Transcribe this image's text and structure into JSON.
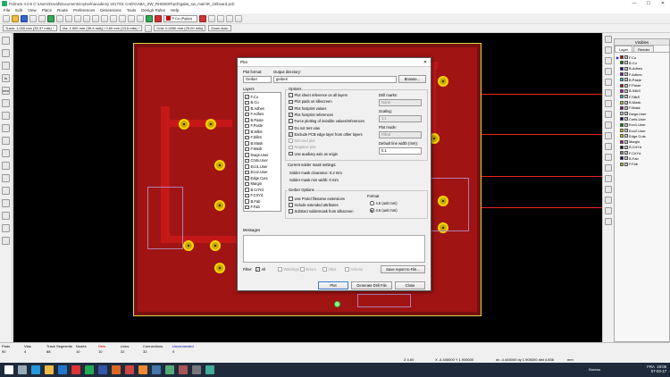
{
  "window": {
    "title": "Pcbnew 4.0.5 C:\\Users\\David\\Documents\\Ayberk\\academy 2017\\01 CAD\\GABA_SW_RHEBOR\\pcb\\gaba_sw_main\\R_15\\board.pcb",
    "minimize": "—",
    "maximize": "☐",
    "close": "✕"
  },
  "menubar": [
    "File",
    "Edit",
    "View",
    "Place",
    "Route",
    "Preferences",
    "Dimensions",
    "Tools",
    "Design Rules",
    "Help"
  ],
  "toolbar": {
    "active_layer": "F.Cu (PgUp)"
  },
  "optionsbar": {
    "track": "Track: 1.000 mm (39.37 mils) *",
    "via": "Via: 1.000 mm (39.4 mils) / 0.60 mm (23.6 mils) *",
    "grid": "Grid: 0.0250 mm (25.00 mils)",
    "zoom": "Zoom Auto"
  },
  "layers_panel": {
    "title": "Visibles",
    "tabs": [
      "Layer",
      "Render"
    ],
    "active_arrow": "▶",
    "rows": [
      {
        "name": "F.Cu",
        "color": "#c00000",
        "checked": true
      },
      {
        "name": "B.Cu",
        "color": "#008000",
        "checked": true
      },
      {
        "name": "B.Adhes",
        "color": "#0000c0",
        "checked": true
      },
      {
        "name": "F.Adhes",
        "color": "#8000c0",
        "checked": true
      },
      {
        "name": "B.Paste",
        "color": "#00c0c0",
        "checked": true
      },
      {
        "name": "F.Paste",
        "color": "#c00000",
        "checked": true
      },
      {
        "name": "B.SilkS",
        "color": "#c000c0",
        "checked": true
      },
      {
        "name": "F.SilkS",
        "color": "#00c0c0",
        "checked": true
      },
      {
        "name": "B.Mask",
        "color": "#c0c000",
        "checked": true
      },
      {
        "name": "F.Mask",
        "color": "#800080",
        "checked": true
      },
      {
        "name": "Dwgs.User",
        "color": "#c0c0c0",
        "checked": true
      },
      {
        "name": "Cmts.User",
        "color": "#000080",
        "checked": true
      },
      {
        "name": "Eco1.User",
        "color": "#008000",
        "checked": true
      },
      {
        "name": "Eco2.User",
        "color": "#c0c000",
        "checked": true
      },
      {
        "name": "Edge.Cuts",
        "color": "#c0c000",
        "checked": true
      },
      {
        "name": "Margin",
        "color": "#c000c0",
        "checked": true
      },
      {
        "name": "B.CrtYd",
        "color": "#000000",
        "checked": true
      },
      {
        "name": "F.CrtYd",
        "color": "#808080",
        "checked": true
      },
      {
        "name": "B.Fab",
        "color": "#000080",
        "checked": true
      },
      {
        "name": "F.Fab",
        "color": "#c0c000",
        "checked": true
      }
    ]
  },
  "status": {
    "cells": [
      {
        "label": "Pads",
        "value": "90"
      },
      {
        "label": "Vias",
        "value": "4"
      },
      {
        "label": "Track Segments",
        "value": "88"
      },
      {
        "label": "Nodes",
        "value": "10"
      },
      {
        "label": "Nets",
        "value": "10"
      },
      {
        "label": "Links",
        "value": "32"
      },
      {
        "label": "Connections",
        "value": "32"
      },
      {
        "label": "Unconnected",
        "value": "0"
      }
    ],
    "zoom": "Z 4.60",
    "xy": "X -4.445000  Y 1.905000",
    "dxy": "dx -4.445000  dy 1.905000  dist 4.836",
    "units": "mm"
  },
  "taskbar": {
    "bureau": "Bureau",
    "lang": "FRA",
    "time": "19:05",
    "date": "07-03-17"
  },
  "dialog": {
    "title": "Plot",
    "close": "✕",
    "plot_format_label": "Plot format:",
    "plot_format_value": "Gerber",
    "output_dir_label": "Output directory:",
    "output_dir_value": "gerber/",
    "browse": "Browse...",
    "layers_label": "Layers",
    "layers": [
      {
        "name": "F.Cu",
        "checked": true
      },
      {
        "name": "B.Cu",
        "checked": false
      },
      {
        "name": "B.Adhes",
        "checked": false
      },
      {
        "name": "F.Adhes",
        "checked": false
      },
      {
        "name": "B.Paste",
        "checked": false
      },
      {
        "name": "F.Paste",
        "checked": false
      },
      {
        "name": "B.SilkS",
        "checked": false
      },
      {
        "name": "F.SilkS",
        "checked": false
      },
      {
        "name": "B.Mask",
        "checked": false
      },
      {
        "name": "F.Mask",
        "checked": false
      },
      {
        "name": "Dwgs.User",
        "checked": false
      },
      {
        "name": "Cmts.User",
        "checked": false
      },
      {
        "name": "Eco1.User",
        "checked": false
      },
      {
        "name": "Eco2.User",
        "checked": false
      },
      {
        "name": "Edge.Cuts",
        "checked": true
      },
      {
        "name": "Margin",
        "checked": false
      },
      {
        "name": "B.CrtYd",
        "checked": false
      },
      {
        "name": "F.CrtYd",
        "checked": false
      },
      {
        "name": "B.Fab",
        "checked": false
      },
      {
        "name": "F.Fab",
        "checked": false
      }
    ],
    "options_label": "Options",
    "options": [
      {
        "label": "Plot sheet reference on all layers",
        "checked": false,
        "disabled": false
      },
      {
        "label": "Plot pads on silkscreen",
        "checked": false,
        "disabled": false
      },
      {
        "label": "Plot footprint values",
        "checked": true,
        "disabled": false
      },
      {
        "label": "Plot footprint references",
        "checked": true,
        "disabled": false
      },
      {
        "label": "Force plotting of invisible values/references",
        "checked": false,
        "disabled": false
      },
      {
        "label": "Do not tent vias",
        "checked": false,
        "disabled": false
      },
      {
        "label": "Exclude PCB edge layer from other layers",
        "checked": true,
        "disabled": false
      },
      {
        "label": "Mirrored plot",
        "checked": false,
        "disabled": true
      },
      {
        "label": "Negative plot",
        "checked": false,
        "disabled": true
      },
      {
        "label": "Use auxiliary axis as origin",
        "checked": false,
        "disabled": false
      }
    ],
    "drill_marks_label": "Drill marks:",
    "drill_marks_value": "None",
    "scaling_label": "Scaling:",
    "scaling_value": "1:1",
    "plot_mode_label": "Plot mode:",
    "plot_mode_value": "Filled",
    "line_width_label": "Default line width (mm):",
    "line_width_value": "0.1",
    "solder_mask_label": "Current solder mask settings:",
    "solder_clearance": "Solder mask clearance:    0.2 mm",
    "solder_min_width": "Solder mask min width:     0 mm",
    "gerber_options_label": "Gerber Options",
    "gerber_options": [
      {
        "label": "Use Protel filename extensions",
        "checked": false
      },
      {
        "label": "Include extended attributes",
        "checked": false
      },
      {
        "label": "Subtract soldermask from silkscreen",
        "checked": false
      }
    ],
    "format_label": "Format",
    "formats": [
      {
        "label": "4.5 (unit mm)",
        "checked": false
      },
      {
        "label": "4.6 (unit mm)",
        "checked": true
      }
    ],
    "messages_label": "Messages",
    "filter_label": "Filter:",
    "filters": [
      {
        "label": "All",
        "checked": true,
        "disabled": false
      },
      {
        "label": "Warnings",
        "checked": false,
        "disabled": true
      },
      {
        "label": "Errors",
        "checked": false,
        "disabled": true
      },
      {
        "label": "Infos",
        "checked": false,
        "disabled": true
      },
      {
        "label": "Actions",
        "checked": false,
        "disabled": true
      }
    ],
    "save_report": "Save report to File...",
    "plot_button": "Plot",
    "drill_button": "Generate Drill File",
    "close_button": "Close"
  }
}
